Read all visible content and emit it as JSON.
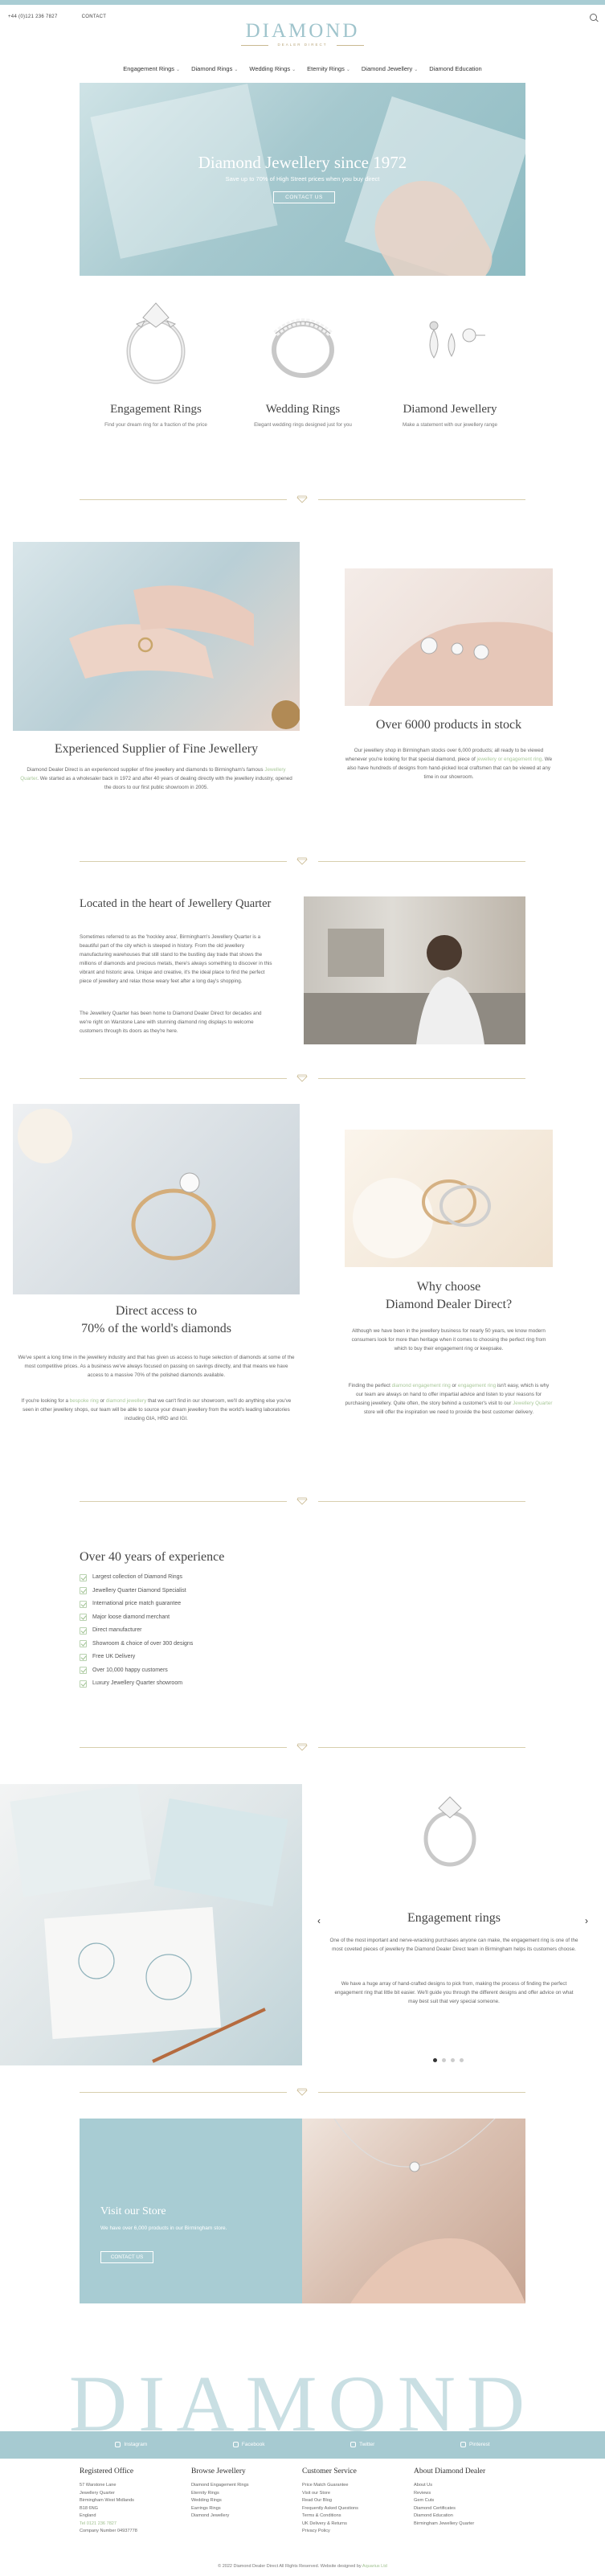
{
  "topbar": {
    "phone": "+44 (0)121 236 7827",
    "contact": "CONTACT"
  },
  "logo": {
    "name": "DIAMOND",
    "tagline": "DEALER DIRECT"
  },
  "nav": [
    "Engagement Rings",
    "Diamond Rings",
    "Wedding Rings",
    "Eternity Rings",
    "Diamond Jewellery",
    "Diamond Education"
  ],
  "hero": {
    "title": "Diamond Jewellery since 1972",
    "subtitle": "Save up to 70% of High Street prices when you buy direct",
    "button": "CONTACT US"
  },
  "categories": [
    {
      "title": "Engagement Rings",
      "text": "Find your dream ring for a fraction of the price"
    },
    {
      "title": "Wedding Rings",
      "text": "Elegant wedding rings designed just for you"
    },
    {
      "title": "Diamond Jewellery",
      "text": "Make a statement with our jewellery range"
    }
  ],
  "supplier": {
    "title": "Experienced Supplier of Fine Jewellery",
    "text_before": "Diamond Dealer Direct is an experienced supplier of fine jewellery and diamonds to Birmingham's famous ",
    "link": "Jewellery Quarter",
    "text_after": ". We started as a wholesaler back in 1972 and after 40 years of dealing directly with the jewellery industry, opened the doors to our first public showroom in 2005."
  },
  "stock": {
    "title": "Over 6000 products in stock",
    "text_before": "Our jewellery shop in Birmingham stocks over 6,000 products; all ready to be viewed whenever you're looking for that special diamond, piece of ",
    "link": "jewellery or engagement ring",
    "text_after": ". We also have hundreds of designs from hand-picked local craftsmen that can be viewed at any time in our showroom."
  },
  "located": {
    "title": "Located in the heart of Jewellery Quarter",
    "p1": "Sometimes referred to as the 'hockley area', Birmingham's Jewellery Quarter is a beautiful part of the city which is steeped in history. From the old jewellery manufacturing warehouses that still stand to the bustling day trade that shows the millions of diamonds and precious metals, there's always something to discover in this vibrant and historic area. Unique and creative, it's the ideal place to find the perfect piece of jewellery and relax those weary feet after a long day's shopping.",
    "p2": "The Jewellery Quarter has been home to Diamond Dealer Direct for decades and we're right on Warstone Lane with stunning diamond ring displays to welcome customers through its doors as they're here."
  },
  "direct": {
    "title_line1": "Direct access to",
    "title_line2": "70% of the world's diamonds",
    "p1": "We've spent a long time in the jewellery industry and that has given us access to huge selection of diamonds at some of the most competitive prices. As a business we've always focused on passing on savings directly, and that means we have access to a massive 70% of the polished diamonds available.",
    "p2_before": "If you're looking for a ",
    "p2_link1": "bespoke ring",
    "p2_mid": " or ",
    "p2_link2": "diamond jewellery",
    "p2_after": " that we can't find in our showroom, we'll do anything else you've seen in other jewellery shops, our team will be able to source your dream jewellery from the world's leading laboratories including GIA, HRD and IGI."
  },
  "why": {
    "title_line1": "Why choose",
    "title_line2": "Diamond Dealer Direct?",
    "p1": "Although we have been in the jewellery business for nearly 50 years, we know modern consumers look for more than heritage when it comes to choosing the perfect ring from which to buy their engagement ring or keepsake.",
    "p2_before": "Finding the perfect ",
    "p2_link1": "diamond engagement ring",
    "p2_mid": " or ",
    "p2_link2": "engagement ring",
    "p2_after": " isn't easy, which is why our team are always on hand to offer impartial advice and listen to your reasons for purchasing jewellery. Quite often, the story behind a customer's visit to our ",
    "p2_link3": "Jewellery Quarter",
    "p2_end": " store will offer the inspiration we need to provide the best customer delivery."
  },
  "experience": {
    "title": "Over 40 years of experience",
    "items": [
      "Largest collection of Diamond Rings",
      "Jewellery Quarter Diamond Specialist",
      "International price match guarantee",
      "Major loose diamond merchant",
      "Direct manufacturer",
      "Showroom & choice of over 300 designs",
      "Free UK Delivery",
      "Over 10,000 happy customers",
      "Luxury Jewellery Quarter showroom"
    ]
  },
  "carousel": {
    "title": "Engagement rings",
    "p1": "One of the most important and nerve-wracking purchases anyone can make, the engagement ring is one of the most coveted pieces of jewellery the Diamond Dealer Direct team in Birmingham helps its customers choose.",
    "p2": "We have a huge array of hand-crafted designs to pick from, making the process of finding the perfect engagement ring that little bit easier. We'll guide you through the different designs and offer advice on what may best suit that very special someone.",
    "prev": "‹",
    "next": "›"
  },
  "visit": {
    "title": "Visit our Store",
    "text": "We have over 6,000 products in our Birmingham store.",
    "button": "CONTACT US"
  },
  "footer": {
    "bigword": "DIAMOND",
    "social": [
      "Instagram",
      "Facebook",
      "Twitter",
      "Pinterest"
    ],
    "columns": [
      {
        "title": "Registered Office",
        "items": [
          "57 Warstone Lane",
          "Jewellery Quarter",
          "Birmingham West Midlands",
          "B18 6NG",
          "England",
          "Tel 0121 236 7827",
          "Company Number 04937778"
        ]
      },
      {
        "title": "Browse Jewellery",
        "items": [
          "Diamond Engagement Rings",
          "Eternity Rings",
          "Wedding Rings",
          "Earrings Rings",
          "Diamond Jewellery"
        ]
      },
      {
        "title": "Customer Service",
        "items": [
          "Price Match Guarantee",
          "Visit our Store",
          "Read Our Blog",
          "Frequently Asked Questions",
          "Terms & Conditions",
          "UK Delivery & Returns",
          "Privacy Policy"
        ]
      },
      {
        "title": "About Diamond Dealer",
        "items": [
          "About Us",
          "Reviews",
          "Gem Cuts",
          "Diamond Certificates",
          "Diamond Education",
          "Birmingham Jewellery Quarter"
        ]
      }
    ],
    "copyright_before": "© 2022 Diamond Dealer Direct All Rights Reserved. Website designed by ",
    "copyright_link": "Aquarius Ltd"
  },
  "colors": {
    "accent": "#a9cdd4",
    "gold": "#c9b991",
    "link": "#a9c89a"
  }
}
